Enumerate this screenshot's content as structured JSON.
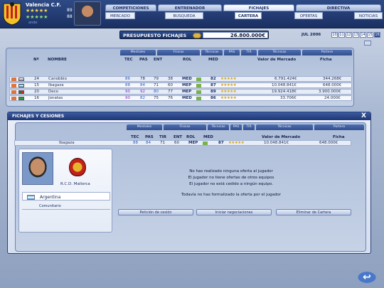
{
  "header": {
    "club_name": "Valencia C.F.",
    "stars_row1": "★★★★★",
    "stars_row2": "★★★★★",
    "num1": "89",
    "num2": "88",
    "sub_label": "ande"
  },
  "main_tabs": [
    "COMPETICIONES",
    "ENTRENADOR",
    "FICHAJES",
    "DIRECTIVA"
  ],
  "sub_tabs": [
    "MERCADO",
    "BUSQUEDA",
    "CARTERA",
    "OFERTAS",
    "NOTICIAS"
  ],
  "budget": {
    "label": "PRESUPUESTO FICHAJES",
    "value": "26.800.000€"
  },
  "calendar": {
    "month": "JUL 2006",
    "days": [
      "10",
      "11",
      "12",
      "13",
      "14",
      "15",
      "16"
    ],
    "today": "16"
  },
  "upper_table": {
    "group_headers": [
      "Mentales",
      "Físicas",
      "Técnicas",
      "PAS",
      "TIR",
      "Técnicas",
      "Portero"
    ],
    "columns": [
      "Nº",
      "NOMBRE",
      "TEC",
      "PAS",
      "ENT",
      "ROL",
      "MED",
      "Valor de Mercado",
      "Ficha"
    ],
    "rows": [
      {
        "num": "24",
        "name": "Canobbio",
        "tec": "86",
        "pas": "78",
        "ent": "79",
        "x": "38",
        "rol": "MED",
        "med": "82",
        "stars": "★★★★★",
        "value": "6.791.424€",
        "ficha": "344.268€"
      },
      {
        "num": "15",
        "name": "Ibagaza",
        "tec": "88",
        "pas": "84",
        "ent": "71",
        "x": "60",
        "rol": "MEP",
        "med": "87",
        "stars": "★★★★★",
        "value": "10.048.841€",
        "ficha": "648.000€"
      },
      {
        "num": "20",
        "name": "Deco",
        "tec": "90",
        "pas": "92",
        "ent": "80",
        "x": "77",
        "rol": "MEP",
        "med": "89",
        "stars": "★★★★★",
        "value": "19.924.418€",
        "ficha": "3.900.000€"
      },
      {
        "num": "16",
        "name": "Jonatas",
        "tec": "90",
        "pas": "82",
        "ent": "75",
        "x": "76",
        "rol": "MED",
        "med": "86",
        "stars": "★★★★★",
        "value": "33.706€",
        "ficha": "24.000€"
      }
    ]
  },
  "modal": {
    "title": "FICHAJES Y CESIONES",
    "close": "X",
    "group_headers": [
      "Mentales",
      "Físicas",
      "Técnicas",
      "PAS",
      "TIR",
      "Técnicas",
      "Portero"
    ],
    "columns": [
      "TEC",
      "PAS",
      "TIR",
      "ENT",
      "ROL",
      "MED",
      "Valor de Mercado",
      "Ficha"
    ],
    "player": {
      "name": "Ibagaza",
      "tec": "88",
      "pas": "84",
      "tir": "71",
      "ent": "60",
      "rol": "MEP",
      "med": "87",
      "stars": "★★★★★",
      "value": "10.048.841€",
      "ficha": "648.000€",
      "club": "R.C.D. Mallorca",
      "nationality": "Argentina",
      "status": "Comunitario"
    },
    "messages": [
      "No has realizado ninguna oferta al jugador",
      "El jugador no tiene ofertas de otros equipos",
      "El jugador no está cedido a ningún equipo.",
      "Todavía no has formalizado la oferta por el jugador"
    ],
    "buttons": [
      "Petición de cesión",
      "Iniciar negociaciones",
      "Eliminar de Cartera"
    ]
  },
  "back_label": "↩"
}
